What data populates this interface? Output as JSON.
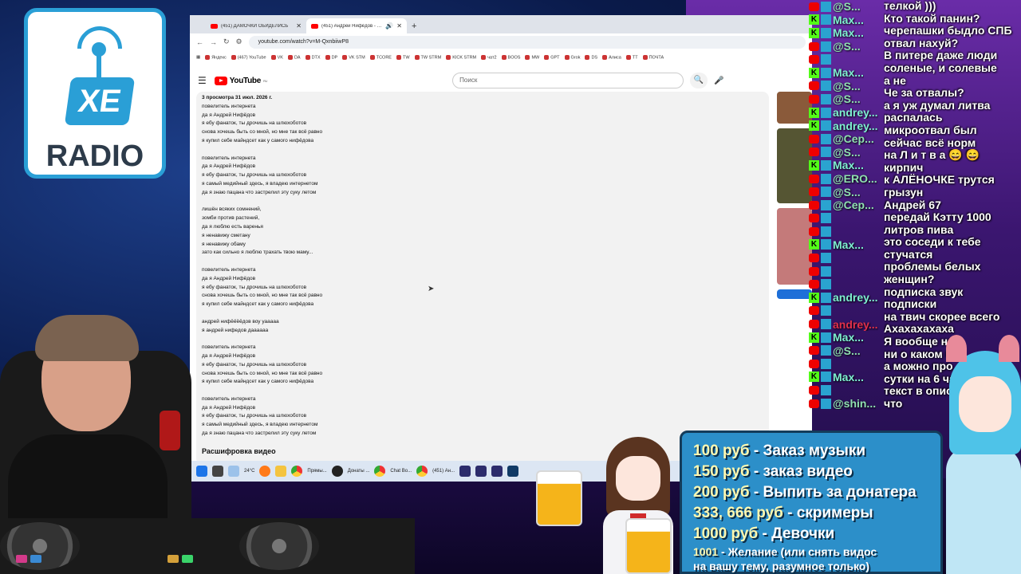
{
  "logo": {
    "badge": "XE",
    "label": "RADIO"
  },
  "browser": {
    "tabs": [
      {
        "title": "(451) ДАМОЧКИ ОБИДЕЛИСЬ",
        "active": false
      },
      {
        "title": "(451) Андрей Нифёдов - YouTube",
        "active": true
      }
    ],
    "new_tab": "+",
    "address": "youtube.com/watch?v=M-QxnbiiwP8",
    "bookmarks": [
      "Яндекс",
      "(467) YouTube",
      "VK",
      "DA",
      "DTX",
      "DP",
      "VK STM",
      "TCORE",
      "TW",
      "TW STRM",
      "KICK STRM",
      "чат2",
      "BOOS",
      "MW",
      "GPT",
      "Grok",
      "DS",
      "Алиса",
      "TT",
      "ПОЧТА"
    ],
    "youtube": {
      "logo": "YouTube",
      "logo_region": "RU",
      "search_placeholder": "Поиск",
      "description": {
        "stats": "3 просмотра  31 июл. 2026 г.",
        "blocks": [
          "повелитель интернета\nда я Андрей Нифёдов\nя ебу фанаток, ты дрочишь на шлюхоботов\nснова хочешь быть со мной, но мне так всё равно\nя купил себе майндсет как у самого нифёдова",
          "повелитель интернета\nда я Андрей Нифёдов\nя ебу фанаток, ты дрочишь на шлюхоботов\nя самый медийный здесь, я владею интернетом\nда я знаю пацана что застрелил эту суку летом",
          "лишён всяких сомнений,\nзомби против растений,\nда я люблю есть варенья\nя ненавижу сметану\nя ненавижу обаму\nзато как сильно я люблю трахать твою маму...",
          "повелитель интернета\nда я Андрей Нифёдов\nя ебу фанаток, ты дрочишь на шлюхоботов\nснова хочешь быть со мной, но мне так всё равно\nя купил себе майндсет как у самого нифёдова",
          "андрей нифёёёёдов воу уааааа\nя андрей нифедов даааааа",
          "повелитель интернета\nда я Андрей Нифёдов\nя ебу фанаток, ты дрочишь на шлюхоботов\nснова хочешь быть со мной, но мне так всё равно\nя купил себе майндсет как у самого нифёдова",
          "повелитель интернета\nда я Андрей Нифёдов\nя ебу фанаток, ты дрочишь на шлюхоботов\nя самый медийный здесь, я владею интернетом\nда я знаю пацана что застрелил эту суку летом"
        ],
        "transcript_heading": "Расшифровка видео"
      }
    }
  },
  "taskbar": {
    "items": [
      "Прямы...",
      "Донаты ...",
      "Chat Bo...",
      "(451) Ан..."
    ],
    "weather": "24°C"
  },
  "chat": {
    "users": [
      {
        "p": "yt",
        "name": "@S..."
      },
      {
        "p": "kick",
        "name": "Max..."
      },
      {
        "p": "kick",
        "name": "Max..."
      },
      {
        "p": "yt",
        "name": "@S..."
      },
      {
        "p": "yt",
        "name": ""
      },
      {
        "p": "kick",
        "name": "Max..."
      },
      {
        "p": "yt",
        "name": "@S..."
      },
      {
        "p": "yt",
        "name": "@S..."
      },
      {
        "p": "kick",
        "name": "andrey..."
      },
      {
        "p": "kick",
        "name": "andrey..."
      },
      {
        "p": "yt",
        "name": "@Сер..."
      },
      {
        "p": "yt",
        "name": "@S..."
      },
      {
        "p": "kick",
        "name": "Max..."
      },
      {
        "p": "yt",
        "name": "@ERO..."
      },
      {
        "p": "yt",
        "name": "@S..."
      },
      {
        "p": "yt",
        "name": "@Сер..."
      },
      {
        "p": "yt",
        "name": ""
      },
      {
        "p": "yt",
        "name": ""
      },
      {
        "p": "kick",
        "name": "Max..."
      },
      {
        "p": "yt",
        "name": ""
      },
      {
        "p": "yt",
        "name": ""
      },
      {
        "p": "yt",
        "name": ""
      },
      {
        "p": "kick",
        "name": "andrey..."
      },
      {
        "p": "yt",
        "name": ""
      },
      {
        "p": "yt",
        "name": "andrey..."
      },
      {
        "p": "kick",
        "name": "Max..."
      },
      {
        "p": "yt",
        "name": "@S..."
      },
      {
        "p": "yt",
        "name": ""
      },
      {
        "p": "kick",
        "name": "Max..."
      },
      {
        "p": "yt",
        "name": ""
      },
      {
        "p": "yt",
        "name": "@shin..."
      }
    ],
    "messages": [
      "телкой )))",
      "Кто такой панин?",
      "черепашки быдло СПБ",
      "отвал нахуй?",
      "В питере даже люди",
      "соленые, и солевые",
      "а не",
      "Че за отвалы?",
      "а я уж думал литва",
      "распалась",
      "микроотвал был",
      "сейчас всё норм",
      "на Л и т в а 😄 😄",
      "кирпич",
      "к АЛЁНОЧКЕ трутся",
      "грызун",
      "Андрей 67",
      "передай Кэтту 1000",
      "литров пива",
      "это соседи к тебе",
      "стучатся",
      "проблемы белых",
      "женщин?",
      "подписка звук",
      "подписки",
      "на твич скорее всего",
      "Ахахахахаха",
      "Я вообще не",
      "ни о каком ко",
      "а можно про",
      "сутки на 6 ча",
      "текст в описа",
      "что"
    ]
  },
  "prices": [
    {
      "amount": "100 руб",
      "label": " - Заказ музыки"
    },
    {
      "amount": "150 руб",
      "label": " - заказ видео"
    },
    {
      "amount": "200 руб",
      "label": " - Выпить за донатера"
    },
    {
      "amount": "333, 666 руб",
      "label": " - скримеры"
    },
    {
      "amount": "1000 руб",
      "label": " - Девочки"
    },
    {
      "amount": "1001",
      "label": " - Желание (или снять видос"
    },
    {
      "amount": "",
      "label": "на вашу тему, разумное только)"
    }
  ],
  "colors": {
    "youtube_red": "#ff0000",
    "kick_green": "#53fc18",
    "price_panel": "#2c8fc9"
  }
}
